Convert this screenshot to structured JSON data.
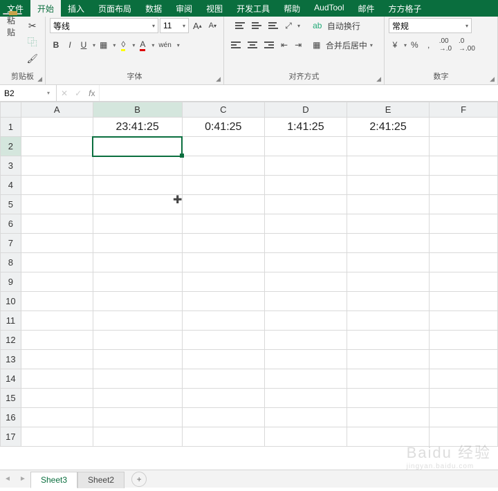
{
  "menu": {
    "tabs": [
      "文件",
      "开始",
      "插入",
      "页面布局",
      "数据",
      "审阅",
      "视图",
      "开发工具",
      "帮助",
      "AudTool",
      "邮件",
      "方方格子"
    ],
    "active": "开始"
  },
  "ribbon": {
    "clipboard": {
      "label": "剪贴板",
      "paste": "粘贴"
    },
    "font": {
      "label": "字体",
      "family": "等线",
      "size": "11",
      "bold": "B",
      "italic": "I",
      "underline": "U",
      "phonetic": "wén"
    },
    "align": {
      "label": "对齐方式",
      "wrap": "自动换行",
      "merge": "合并后居中"
    },
    "number": {
      "label": "数字",
      "format": "常规",
      "currency": "%",
      "percent": "%",
      "comma": ","
    }
  },
  "namebox": "B2",
  "formula": "",
  "columns": [
    "A",
    "B",
    "C",
    "D",
    "E",
    "F"
  ],
  "rows": [
    "1",
    "2",
    "3",
    "4",
    "5",
    "6",
    "7",
    "8",
    "9",
    "10",
    "11",
    "12",
    "13",
    "14",
    "15",
    "16",
    "17"
  ],
  "cells": {
    "B1": "23:41:25",
    "C1": "0:41:25",
    "D1": "1:41:25",
    "E1": "2:41:25"
  },
  "selected": "B2",
  "sheets": {
    "list": [
      "Sheet3",
      "Sheet2"
    ],
    "active": "Sheet3"
  },
  "watermark": {
    "main": "Baidu 经验",
    "sub": "jingyan.baidu.com"
  }
}
